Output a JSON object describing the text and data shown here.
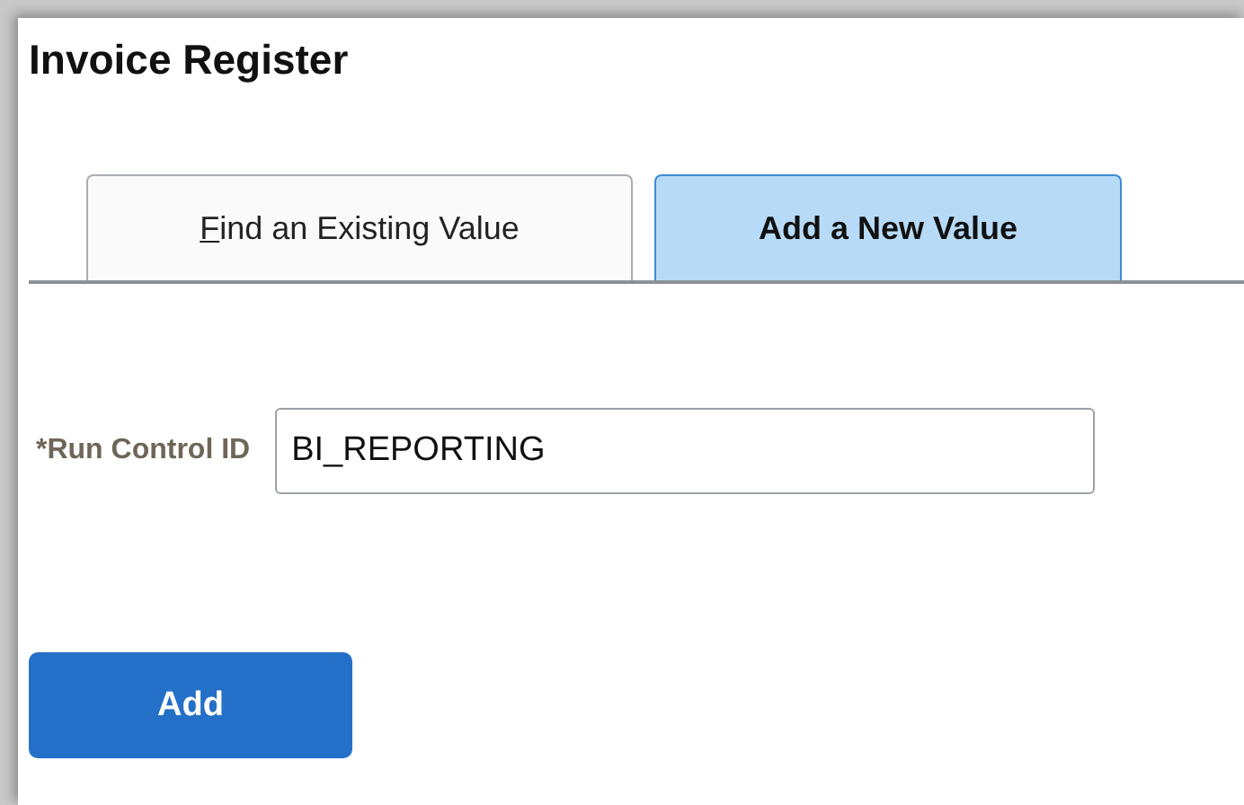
{
  "window": {
    "title": "Invoice Register"
  },
  "tabs": [
    {
      "label": "Find an Existing Value",
      "selected": false,
      "access_key": true
    },
    {
      "label": "Add a New Value",
      "selected": true,
      "access_key": false
    }
  ],
  "form": {
    "label": "*Run Control ID",
    "value": "BI_REPORTING"
  },
  "buttons": [
    "Add"
  ]
}
